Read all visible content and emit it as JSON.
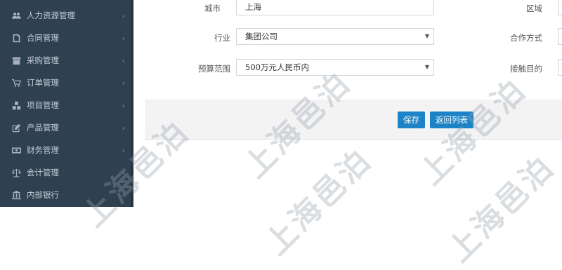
{
  "sidebar": {
    "items": [
      {
        "label": "人力资源管理",
        "icon": "users-icon"
      },
      {
        "label": "合同管理",
        "icon": "document-icon"
      },
      {
        "label": "采购管理",
        "icon": "archive-icon"
      },
      {
        "label": "订单管理",
        "icon": "cart-icon"
      },
      {
        "label": "项目管理",
        "icon": "cubes-icon"
      },
      {
        "label": "产品管理",
        "icon": "edit-icon"
      },
      {
        "label": "财务管理",
        "icon": "money-icon"
      },
      {
        "label": "会计管理",
        "icon": "balance-scale-icon"
      },
      {
        "label": "内部银行",
        "icon": "bank-icon"
      }
    ],
    "chevron": "‹"
  },
  "form": {
    "city": {
      "label": "城市",
      "value": "上海"
    },
    "district": {
      "label": "区域"
    },
    "industry": {
      "label": "行业",
      "value": "集团公司"
    },
    "cooperation": {
      "label": "合作方式"
    },
    "budget": {
      "label": "预算范围",
      "value": "500万元人民币内"
    },
    "contact_purpose": {
      "label": "接触目的"
    }
  },
  "buttons": {
    "save": "保存",
    "back": "返回列表"
  },
  "watermark": "上海邑泊",
  "colors": {
    "sidebar_bg": "#2f4050",
    "primary": "#1c84c6"
  }
}
